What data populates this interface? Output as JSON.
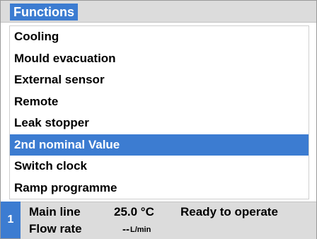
{
  "header": {
    "title": "Functions"
  },
  "menu": {
    "items": [
      {
        "label": "Cooling"
      },
      {
        "label": "Mould evacuation"
      },
      {
        "label": "External sensor"
      },
      {
        "label": "Remote"
      },
      {
        "label": "Leak stopper"
      },
      {
        "label": "2nd nominal Value",
        "selected": true
      },
      {
        "label": "Switch clock"
      },
      {
        "label": "Ramp programme"
      }
    ]
  },
  "status": {
    "unit_number": "1",
    "line1_label": "Main line",
    "line1_value": "25.0 °C",
    "state_text": "Ready to operate",
    "line2_label": "Flow rate",
    "line2_value": "--",
    "line2_unit": "L/min"
  },
  "colors": {
    "accent": "#3c7cd1",
    "panel": "#dcdcdc"
  }
}
